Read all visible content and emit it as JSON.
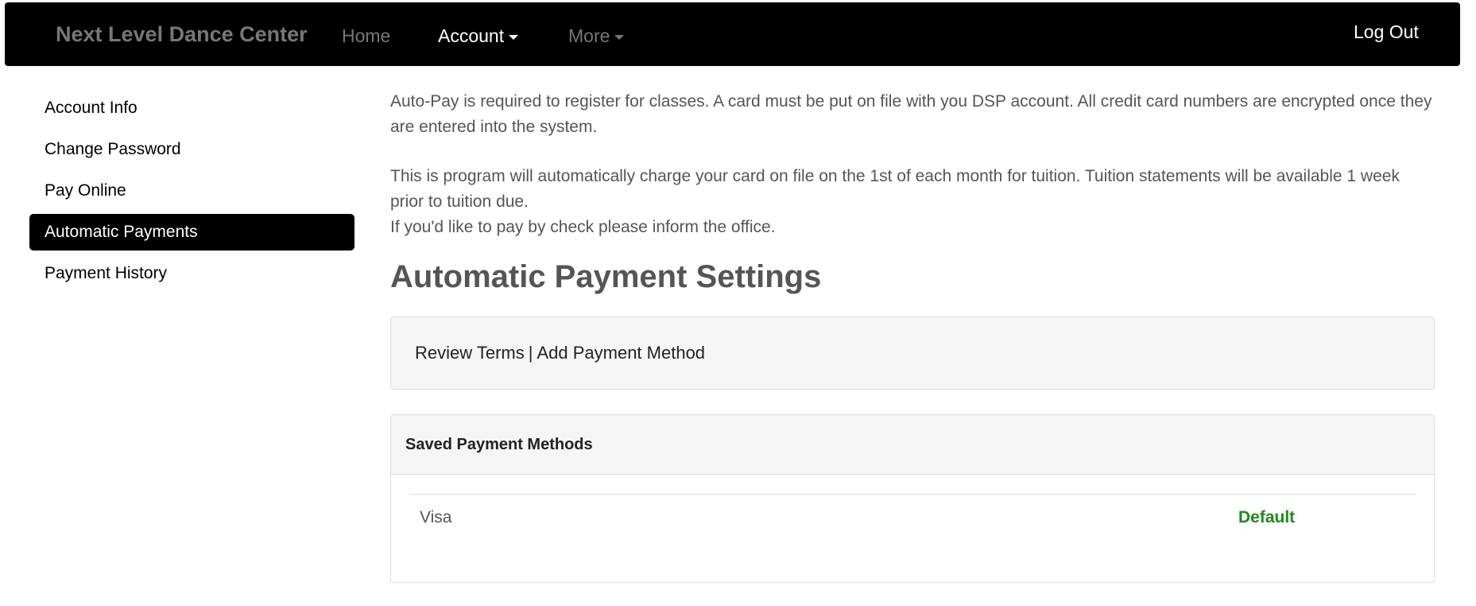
{
  "navbar": {
    "brand": "Next Level Dance Center",
    "home": "Home",
    "account": "Account",
    "more": "More",
    "logout": "Log Out"
  },
  "sidebar": {
    "items": [
      {
        "label": "Account Info",
        "active": false
      },
      {
        "label": "Change Password",
        "active": false
      },
      {
        "label": "Pay Online",
        "active": false
      },
      {
        "label": "Automatic Payments",
        "active": true
      },
      {
        "label": "Payment History",
        "active": false
      }
    ]
  },
  "main": {
    "intro_1": "Auto-Pay is required to register for classes. A card must be put on file with you DSP account. All credit card numbers are encrypted once they are entered into the system.",
    "intro_2": "This is program will automatically charge your card on file on the 1st of each month for tuition. Tuition statements will be available 1 week prior to tuition due.",
    "intro_3": "If you'd like to pay by check please inform the office.",
    "title": "Automatic Payment Settings",
    "review_terms": "Review Terms",
    "separator": "|",
    "add_payment_method": "Add Payment Method",
    "saved_heading": "Saved Payment Methods",
    "methods": [
      {
        "name": "Visa",
        "status": "Default"
      }
    ]
  },
  "colors": {
    "navbar_bg": "#000000",
    "active_item_bg": "#000000",
    "default_status": "#1c8a1c"
  }
}
